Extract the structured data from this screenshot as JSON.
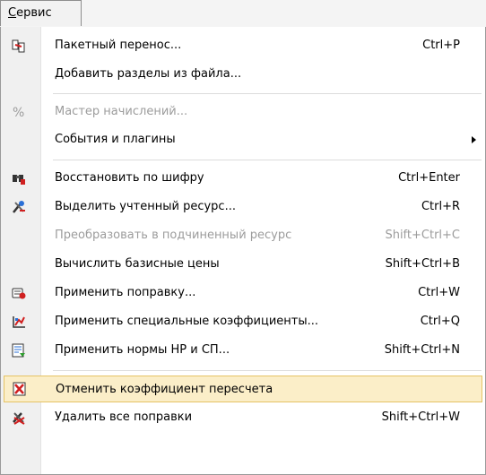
{
  "menu": {
    "title": "Сервис"
  },
  "items": [
    {
      "label": "Пакетный перенос...",
      "shortcut": "Ctrl+P"
    },
    {
      "label": "Добавить разделы из файла...",
      "shortcut": ""
    },
    {
      "label": "Мастер начислений...",
      "shortcut": ""
    },
    {
      "label": "События и плагины",
      "shortcut": ""
    },
    {
      "label": "Восстановить по шифру",
      "shortcut": "Ctrl+Enter"
    },
    {
      "label": "Выделить учтенный ресурс...",
      "shortcut": "Ctrl+R"
    },
    {
      "label": "Преобразовать в подчиненный ресурс",
      "shortcut": "Shift+Ctrl+C"
    },
    {
      "label": "Вычислить базисные цены",
      "shortcut": "Shift+Ctrl+B"
    },
    {
      "label": "Применить поправку...",
      "shortcut": "Ctrl+W"
    },
    {
      "label": "Применить специальные коэффициенты...",
      "shortcut": "Ctrl+Q"
    },
    {
      "label": "Применить нормы НР и СП...",
      "shortcut": "Shift+Ctrl+N"
    },
    {
      "label": "Отменить коэффициент пересчета",
      "shortcut": ""
    },
    {
      "label": "Удалить все поправки",
      "shortcut": "Shift+Ctrl+W"
    }
  ],
  "colors": {
    "highlight": "#fbeec8",
    "highlight_border": "#e5c365",
    "disabled_text": "#9c9c9c"
  }
}
